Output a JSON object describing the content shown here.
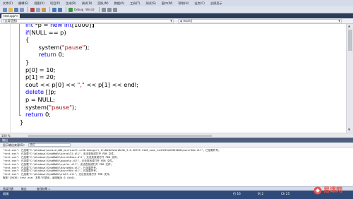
{
  "menubar": {
    "items": [
      "文件(F)",
      "编辑(E)",
      "视图(V)",
      "项目(P)",
      "生成(B)",
      "调试(D)",
      "团队(M)",
      "数据(A)",
      "工具(T)",
      "测试(S)",
      "窗口(W)",
      "帮助(H)",
      "社交(C)",
      "全屏显示"
    ]
  },
  "toolbar": {
    "config": "Debug",
    "platform": "Win32"
  },
  "tab": {
    "title": "test.cpp*",
    "close": "×"
  },
  "navbar": {
    "scope": "(全局范围)",
    "function": "main()"
  },
  "code": {
    "lines": [
      [
        {
          "t": "int",
          "c": "kw"
        },
        {
          "t": " *p = "
        },
        {
          "t": "new",
          "c": "kw"
        },
        {
          "t": " "
        },
        {
          "t": "int",
          "c": "kw"
        },
        {
          "t": "[1000];"
        }
      ],
      [
        {
          "t": "if",
          "c": "kw"
        },
        {
          "t": "(NULL == p)"
        }
      ],
      [
        {
          "t": "{"
        }
      ],
      [
        {
          "t": "    system("
        },
        {
          "t": "\"pause\"",
          "c": "str"
        },
        {
          "t": ");"
        }
      ],
      [
        {
          "t": "    "
        },
        {
          "t": "return",
          "c": "kw"
        },
        {
          "t": " 0;"
        }
      ],
      [
        {
          "t": "}"
        }
      ],
      [
        {
          "t": "p[0] = 10;"
        }
      ],
      [
        {
          "t": "p[1] = 20;"
        }
      ],
      [
        {
          "t": "cout << p[0] << "
        },
        {
          "t": "\",\"",
          "c": "str"
        },
        {
          "t": " << p[1] << endl;"
        }
      ],
      [
        {
          "t": "delete",
          "c": "kw"
        },
        {
          "t": " []p;"
        }
      ],
      [
        {
          "t": "p = NULL;"
        }
      ],
      [
        {
          "t": "system("
        },
        {
          "t": "\"pause\"",
          "c": "str"
        },
        {
          "t": ");"
        }
      ],
      [
        {
          "t": "return",
          "c": "kw"
        },
        {
          "t": " 0;"
        }
      ],
      [
        {
          "t": "}"
        }
      ]
    ]
  },
  "editor": {
    "zoom": "100 %"
  },
  "output": {
    "title": "输出",
    "show_label": "显示输出来源(S):",
    "show_value": "调试",
    "lines": [
      "\"test.exe\": 已加载\"C:\\Windows\\winsxs\\x86_microsoft.vc90.debugcrt_1fc8b3b9a1e18e3b_9.0.30729.4148_none_2a4f639a55563668\\msvcr90d.dll\"，已加载符号。",
      "\"test.exe\": 已加载\"C:\\Windows\\SysWOW64\\kernel32.dll\"，无法查找或打开 PDB 文件。",
      "\"test.exe\": 已加载\"C:\\Windows\\SysWOW64\\KernelBase.dll\"，无法查找或打开 PDB 文件。",
      "\"test.exe\": 已加载\"C:\\Windows\\SysWOW64\\apphelp.dll\"，无法查找或打开 PDB 文件。",
      "\"test.exe\": 已加载\"C:\\Windows\\SysWOW64\\sysfer.dll\"，无法查找或打开 PDB 文件。",
      "\"test.exe\": 已加载\"C:\\Windows\\SysWOW64\\msvcp90d.dll\"，已加载符号。",
      "\"test.exe\": 已加载\"C:\\Windows\\SysWOW64\\msvcr90d.dll\"，已加载符号。",
      "\"test.exe\": 已加载\"C:\\Windows\\SysWOW64\\ntdll.dll\"，无法查找或打开 PDB 文件。",
      "程序\"[9636] test.exe: 本机\"已退出，返回值为 0 (0x0)。"
    ]
  },
  "output_tabs": [
    "错误列表",
    "输出",
    "查找结果 1"
  ],
  "status": {
    "ready": "就绪",
    "line": "行 16",
    "col": "列 2",
    "ch": "Ch 25",
    "mode": "Ins"
  },
  "logo": {
    "text": "易课网"
  }
}
